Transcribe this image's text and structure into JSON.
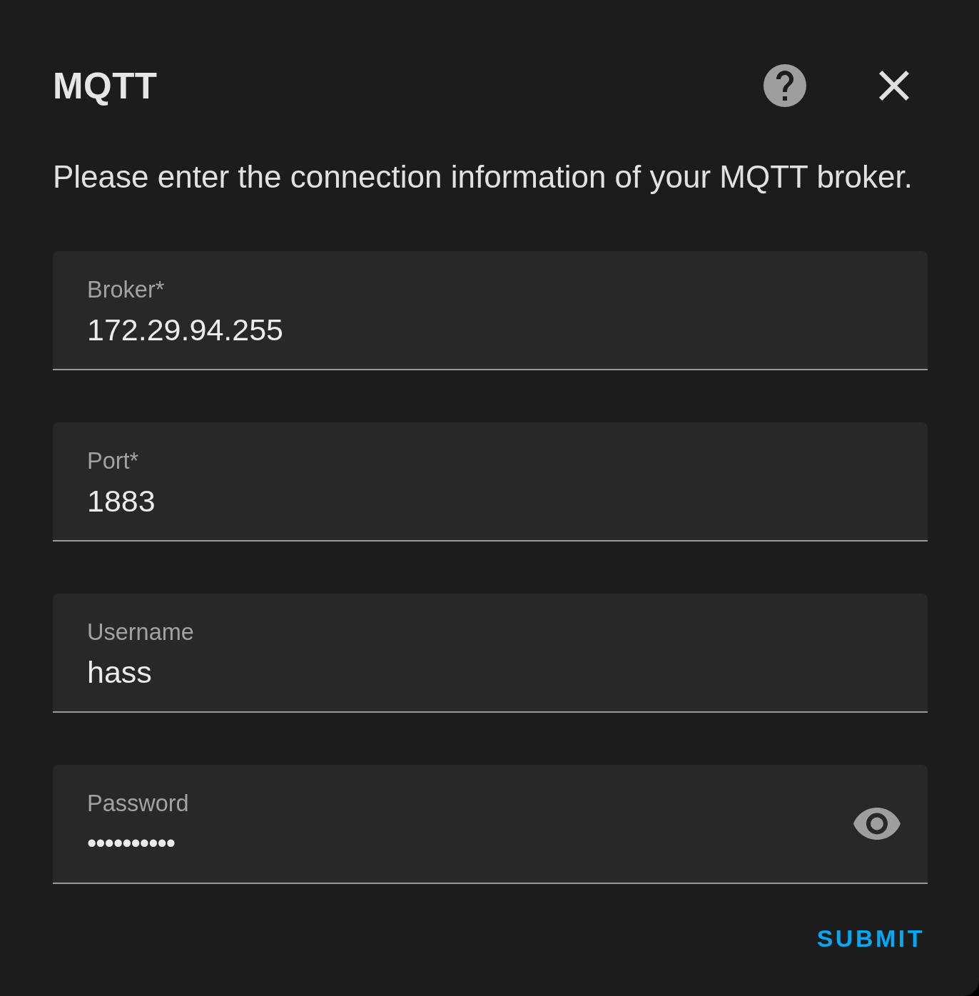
{
  "dialog": {
    "title": "MQTT",
    "description": "Please enter the connection information of your MQTT broker.",
    "fields": [
      {
        "kind": "text",
        "label": "Broker*",
        "value": "172.29.94.255"
      },
      {
        "kind": "text",
        "label": "Port*",
        "value": "1883"
      },
      {
        "kind": "text",
        "label": "Username",
        "value": "hass"
      },
      {
        "kind": "password",
        "label": "Password",
        "value": "••••••••••"
      }
    ],
    "submit": "SUBMIT"
  }
}
